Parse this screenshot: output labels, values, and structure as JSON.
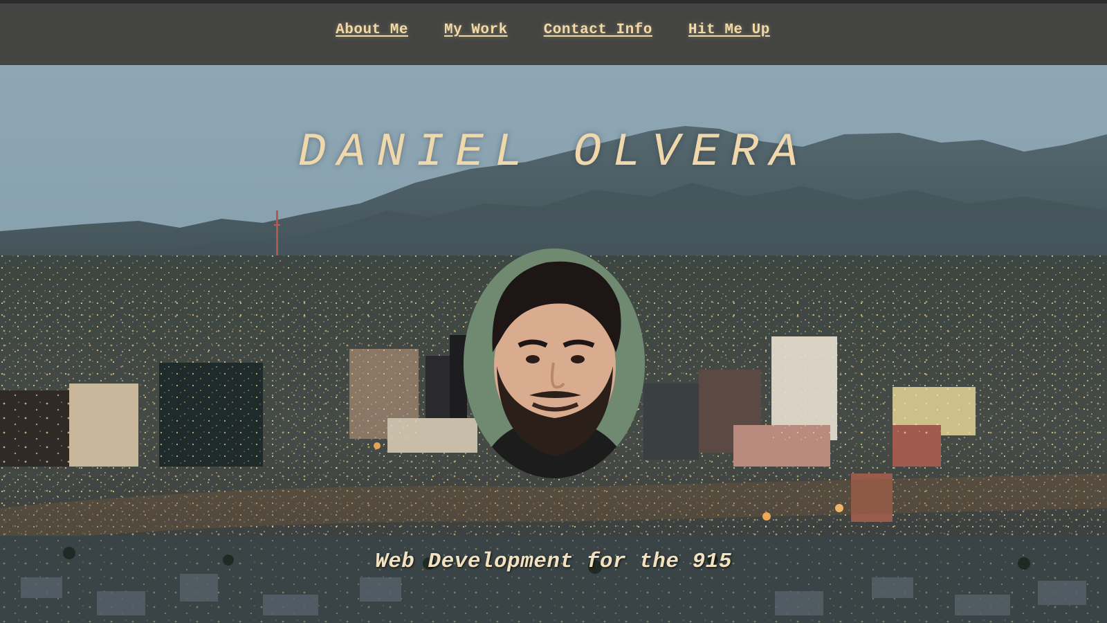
{
  "nav": {
    "items": [
      {
        "label": "About Me"
      },
      {
        "label": "My Work"
      },
      {
        "label": "Contact Info"
      },
      {
        "label": "Hit Me Up"
      }
    ]
  },
  "hero": {
    "title": "DANIEL OLVERA",
    "tagline": "Web Development for the 915",
    "background": "city-skyline-with-mountains-photo",
    "avatar": "profile-photo"
  },
  "colors": {
    "nav_background": "#444543",
    "link_color": "#f2d9a8",
    "title_color": "#f0d8ad",
    "tagline_color": "#f3e2c0"
  }
}
